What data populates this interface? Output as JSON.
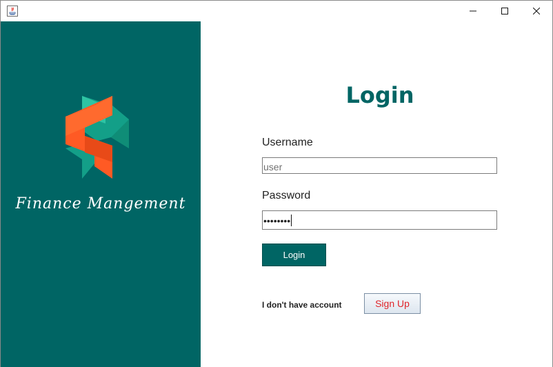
{
  "window": {
    "controls": {
      "minimize_icon": "minimize-icon",
      "maximize_icon": "maximize-icon",
      "close_icon": "close-icon"
    }
  },
  "brand": {
    "name": "Finance Mangement",
    "panel_color": "#006564",
    "logo_colors": [
      "#ff5a24",
      "#16a98e"
    ]
  },
  "login": {
    "title": "Login",
    "username_label": "Username",
    "username_value": "user",
    "password_label": "Password",
    "password_mask": "••••••••",
    "login_button": "Login",
    "no_account_text": "I don't have account",
    "signup_button": "Sign Up",
    "accent_color": "#006564",
    "signup_text_color": "#e0242a"
  }
}
